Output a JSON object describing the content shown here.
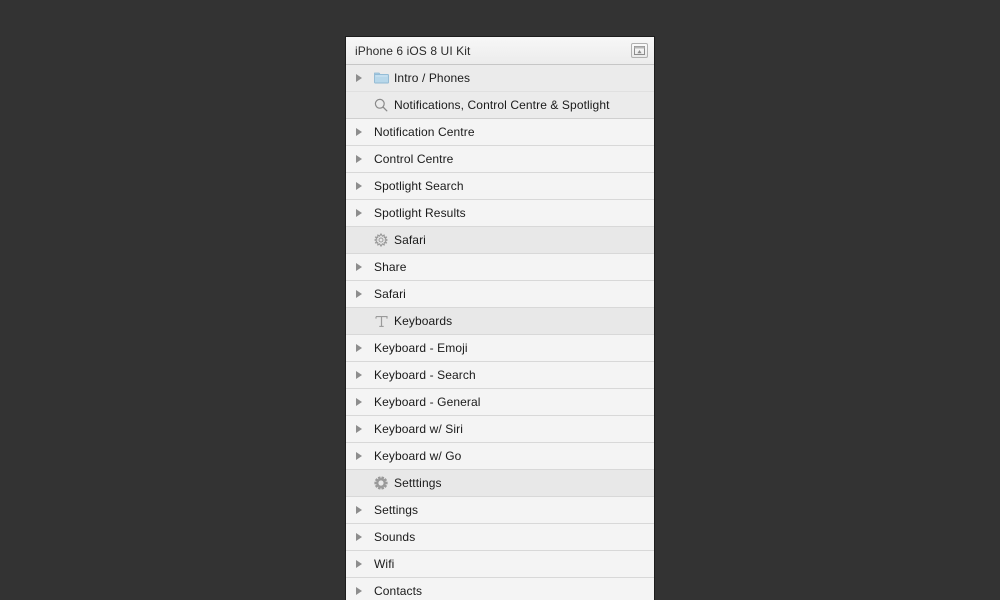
{
  "window": {
    "background_color": "#333333",
    "panel_background": "#f2f2f2",
    "border_color": "#1d1d1d"
  },
  "panel": {
    "title": "iPhone 6 iOS 8 UI Kit",
    "header_button": {
      "name": "panel-collapse-button",
      "icon": "window-collapse-icon"
    }
  },
  "list": {
    "rows": [
      {
        "label": "Intro / Phones",
        "disclosure": true,
        "icon": "folder-icon",
        "style": "group"
      },
      {
        "label": "Notifications, Control Centre & Spotlight",
        "disclosure": false,
        "icon": "search-icon",
        "style": "group-last"
      },
      {
        "label": "Notification Centre",
        "disclosure": true,
        "icon": "none",
        "style": "normal"
      },
      {
        "label": "Control Centre",
        "disclosure": true,
        "icon": "none",
        "style": "normal"
      },
      {
        "label": "Spotlight Search",
        "disclosure": true,
        "icon": "none",
        "style": "normal"
      },
      {
        "label": "Spotlight Results",
        "disclosure": true,
        "icon": "none",
        "style": "normal"
      },
      {
        "label": "Safari",
        "disclosure": false,
        "icon": "compass-icon",
        "style": "selected"
      },
      {
        "label": "Share",
        "disclosure": true,
        "icon": "none",
        "style": "normal"
      },
      {
        "label": "Safari",
        "disclosure": true,
        "icon": "none",
        "style": "normal"
      },
      {
        "label": "Keyboards",
        "disclosure": false,
        "icon": "text-type-icon",
        "style": "selected"
      },
      {
        "label": "Keyboard - Emoji",
        "disclosure": true,
        "icon": "none",
        "style": "normal"
      },
      {
        "label": "Keyboard - Search",
        "disclosure": true,
        "icon": "none",
        "style": "normal"
      },
      {
        "label": "Keyboard - General",
        "disclosure": true,
        "icon": "none",
        "style": "normal"
      },
      {
        "label": "Keyboard w/ Siri",
        "disclosure": true,
        "icon": "none",
        "style": "normal"
      },
      {
        "label": "Keyboard w/ Go",
        "disclosure": true,
        "icon": "none",
        "style": "normal"
      },
      {
        "label": "Setttings",
        "disclosure": false,
        "icon": "gear-icon",
        "style": "selected"
      },
      {
        "label": "Settings",
        "disclosure": true,
        "icon": "none",
        "style": "normal"
      },
      {
        "label": "Sounds",
        "disclosure": true,
        "icon": "none",
        "style": "normal"
      },
      {
        "label": "Wifi",
        "disclosure": true,
        "icon": "none",
        "style": "normal"
      },
      {
        "label": "Contacts",
        "disclosure": true,
        "icon": "none",
        "style": "normal"
      }
    ]
  }
}
